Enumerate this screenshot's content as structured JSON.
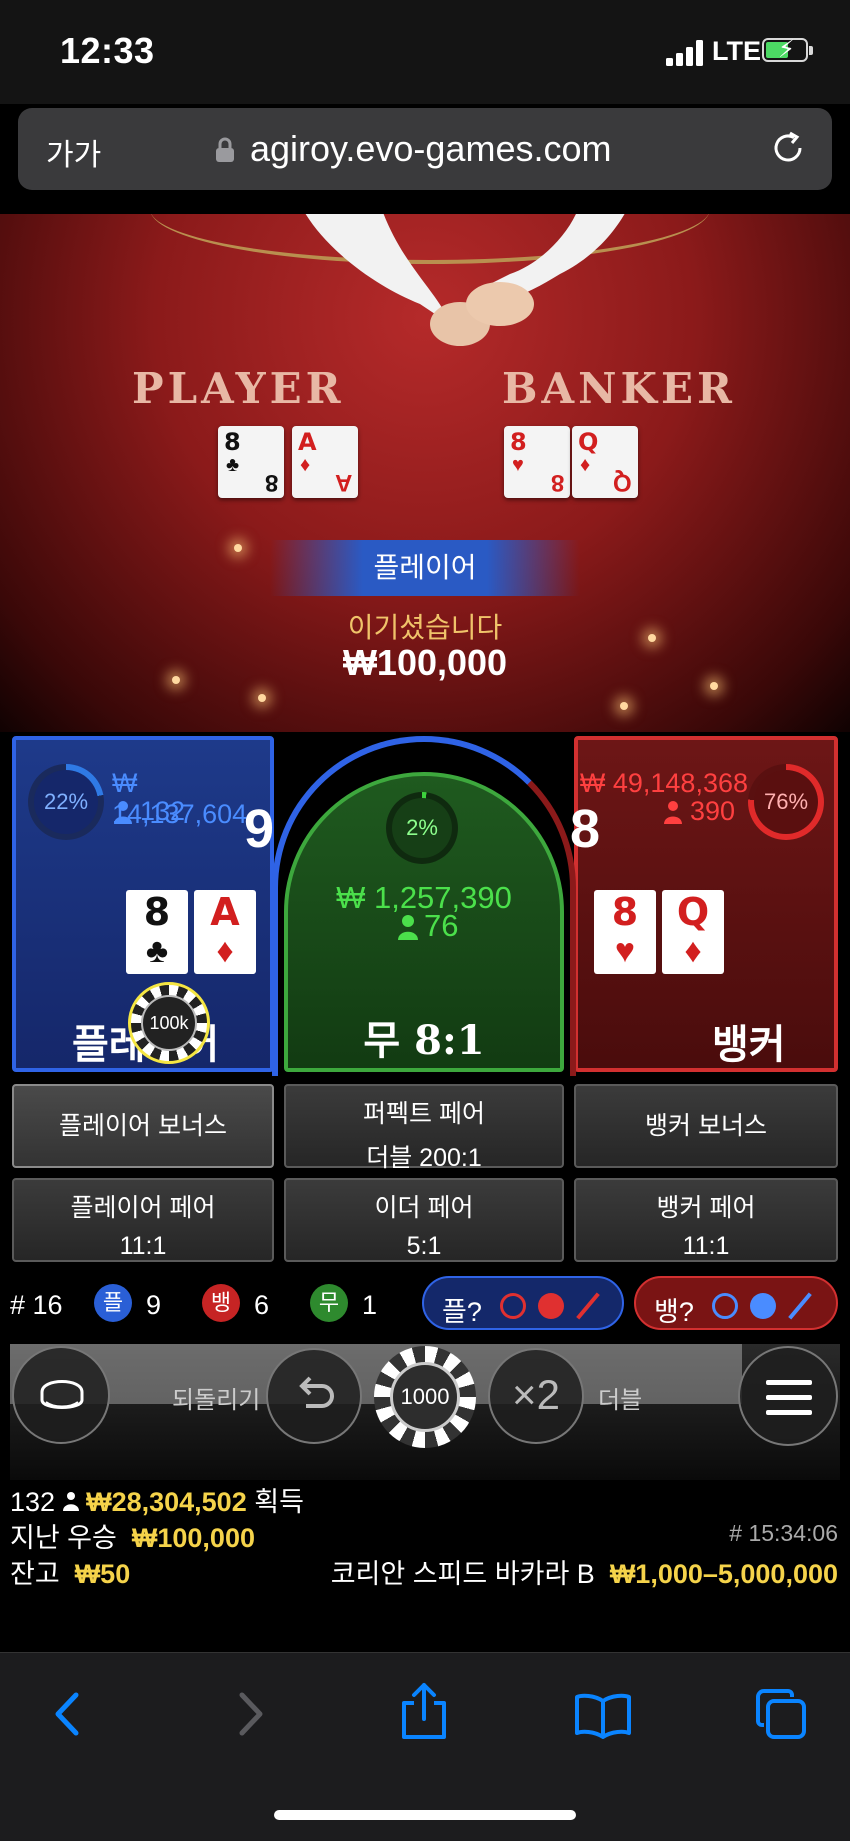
{
  "status_bar": {
    "time": "12:33",
    "network": "LTE"
  },
  "browser": {
    "text_size": "가가",
    "url": "agiroy.evo-games.com"
  },
  "table": {
    "player_label": "PLAYER",
    "banker_label": "BANKER",
    "player_cards": [
      {
        "rank": "8",
        "suit": "♣",
        "color": "black"
      },
      {
        "rank": "A",
        "suit": "♦",
        "color": "red"
      }
    ],
    "banker_cards": [
      {
        "rank": "8",
        "suit": "♥",
        "color": "red"
      },
      {
        "rank": "Q",
        "suit": "♦",
        "color": "red"
      }
    ]
  },
  "result": {
    "winner": "플레이어",
    "message": "이기셨습니다",
    "amount": "₩100,000"
  },
  "bets": {
    "player": {
      "percent": "22%",
      "percent_value": 22,
      "amount": "₩ 14,137,604",
      "players": "132",
      "score": "9",
      "label": "플레이어",
      "chip": "100k"
    },
    "tie": {
      "percent": "2%",
      "percent_value": 2,
      "amount": "₩ 1,257,390",
      "players": "76",
      "label": "무 8:1"
    },
    "banker": {
      "percent": "76%",
      "percent_value": 76,
      "amount": "₩ 49,148,368",
      "players": "390",
      "score": "8",
      "label": "뱅커"
    }
  },
  "side_bets": {
    "player_bonus": "플레이어 보너스",
    "perfect_pair": "퍼펙트 페어",
    "perfect_pair_odds": "더블 200:1",
    "banker_bonus": "뱅커 보너스",
    "player_pair": "플레이어 페어",
    "player_pair_odds": "11:1",
    "either_pair": "이더 페어",
    "either_pair_odds": "5:1",
    "banker_pair": "뱅커 페어",
    "banker_pair_odds": "11:1"
  },
  "road_stats": {
    "rounds_label": "# 16",
    "player_bubble": "플",
    "player_count": "9",
    "banker_bubble": "뱅",
    "banker_count": "6",
    "tie_bubble": "무",
    "tie_count": "1",
    "player_predict": "플?",
    "banker_predict": "뱅?"
  },
  "controls": {
    "undo_label": "되돌리기",
    "chip_value": "1000",
    "double_symbol": "×2",
    "double_label": "더블"
  },
  "info": {
    "players_online": "132",
    "total_won": "₩28,304,502",
    "won_label": "획득",
    "last_win_label": "지난 우승",
    "last_win": "₩100,000",
    "round_id": "# 15:34:06",
    "balance_label": "잔고",
    "balance": "₩50",
    "table_name": "코리안 스피드 바카라 B",
    "limits": "₩1,000–5,000,000"
  },
  "colors": {
    "player_blue": "#2f63e6",
    "banker_red": "#d23030",
    "tie_green": "#3da83d",
    "gold": "#f5d34a",
    "ios_blue": "#0a84ff"
  }
}
